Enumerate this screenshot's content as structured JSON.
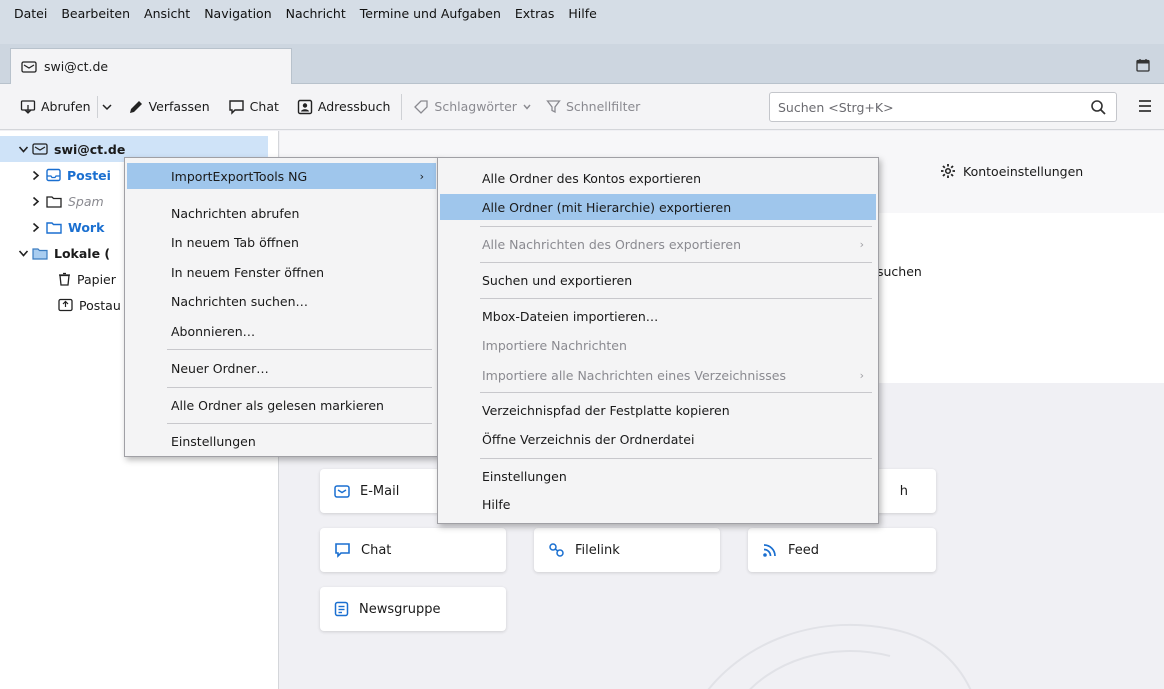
{
  "menubar": {
    "items": [
      "Datei",
      "Bearbeiten",
      "Ansicht",
      "Navigation",
      "Nachricht",
      "Termine und Aufgaben",
      "Extras",
      "Hilfe"
    ]
  },
  "tab": {
    "label": "swi@ct.de"
  },
  "toolbar": {
    "get_messages": "Abrufen",
    "compose": "Verfassen",
    "chat": "Chat",
    "address_book": "Adressbuch",
    "tags": "Schlagwörter",
    "quick_filter": "Schnellfilter",
    "search_placeholder": "Suchen <Strg+K>"
  },
  "sidebar": {
    "account": "swi@ct.de",
    "folders": [
      "Postei",
      "Spam",
      "Work",
      "Lokale (",
      "Papier",
      "Postau"
    ]
  },
  "main": {
    "account_settings": "Kontoeinstellungen",
    "search_partial": "suchen",
    "cards": {
      "email": "E-Mail",
      "partial": "h",
      "chat": "Chat",
      "filelink": "Filelink",
      "feed": "Feed",
      "newsgroup": "Newsgruppe"
    }
  },
  "context_menu": {
    "items": [
      "ImportExportTools NG",
      "Nachrichten abrufen",
      "In neuem Tab öffnen",
      "In neuem Fenster öffnen",
      "Nachrichten suchen…",
      "Abonnieren…",
      "Neuer Ordner…",
      "Alle Ordner als gelesen markieren",
      "Einstellungen"
    ]
  },
  "submenu": {
    "items": [
      "Alle Ordner des Kontos exportieren",
      "Alle Ordner (mit Hierarchie) exportieren",
      "Alle Nachrichten des Ordners exportieren",
      "Suchen und exportieren",
      "Mbox-Dateien importieren…",
      "Importiere Nachrichten",
      "Importiere alle Nachrichten eines Verzeichnisses",
      "Verzeichnispfad der Festplatte kopieren",
      "Öffne Verzeichnis der Ordnerdatei",
      "Einstellungen",
      "Hilfe"
    ]
  },
  "colors": {
    "accent": "#1a6fd0",
    "selection": "#9fc6ec",
    "folder_selected": "#cfe3f8",
    "menubar_bg": "#d5dde6"
  }
}
